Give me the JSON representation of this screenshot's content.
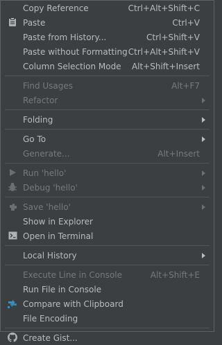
{
  "menu": {
    "groups": [
      [
        {
          "label": "Copy Reference",
          "shortcut": "Ctrl+Alt+Shift+C",
          "icon": "",
          "disabled": false,
          "submenu": false
        },
        {
          "label": "Paste",
          "shortcut": "Ctrl+V",
          "icon": "clipboard-icon",
          "disabled": false,
          "submenu": false
        },
        {
          "label": "Paste from History...",
          "shortcut": "Ctrl+Shift+V",
          "icon": "",
          "disabled": false,
          "submenu": false
        },
        {
          "label": "Paste without Formatting",
          "shortcut": "Ctrl+Alt+Shift+V",
          "icon": "",
          "disabled": false,
          "submenu": false
        },
        {
          "label": "Column Selection Mode",
          "shortcut": "Alt+Shift+Insert",
          "icon": "",
          "disabled": false,
          "submenu": false
        }
      ],
      [
        {
          "label": "Find Usages",
          "shortcut": "Alt+F7",
          "icon": "",
          "disabled": true,
          "submenu": false
        },
        {
          "label": "Refactor",
          "shortcut": "",
          "icon": "",
          "disabled": true,
          "submenu": true
        }
      ],
      [
        {
          "label": "Folding",
          "shortcut": "",
          "icon": "",
          "disabled": false,
          "submenu": true
        }
      ],
      [
        {
          "label": "Go To",
          "shortcut": "",
          "icon": "",
          "disabled": false,
          "submenu": true
        },
        {
          "label": "Generate...",
          "shortcut": "Alt+Insert",
          "icon": "",
          "disabled": true,
          "submenu": false
        }
      ],
      [
        {
          "label": "Run 'hello'",
          "shortcut": "",
          "icon": "run-icon",
          "disabled": true,
          "submenu": true
        },
        {
          "label": "Debug 'hello'",
          "shortcut": "",
          "icon": "debug-icon",
          "disabled": true,
          "submenu": true
        }
      ],
      [
        {
          "label": "Save 'hello'",
          "shortcut": "",
          "icon": "save-config-icon",
          "disabled": true,
          "submenu": true
        },
        {
          "label": "Show in Explorer",
          "shortcut": "",
          "icon": "",
          "disabled": false,
          "submenu": false
        },
        {
          "label": "Open in Terminal",
          "shortcut": "",
          "icon": "terminal-icon",
          "disabled": false,
          "submenu": false
        }
      ],
      [
        {
          "label": "Local History",
          "shortcut": "",
          "icon": "",
          "disabled": false,
          "submenu": true
        }
      ],
      [
        {
          "label": "Execute Line in Console",
          "shortcut": "Alt+Shift+E",
          "icon": "",
          "disabled": true,
          "submenu": false
        },
        {
          "label": "Run File in Console",
          "shortcut": "",
          "icon": "",
          "disabled": false,
          "submenu": false
        },
        {
          "label": "Compare with Clipboard",
          "shortcut": "",
          "icon": "compare-icon",
          "disabled": false,
          "submenu": false
        },
        {
          "label": "File Encoding",
          "shortcut": "",
          "icon": "",
          "disabled": false,
          "submenu": false
        }
      ],
      [
        {
          "label": "Create Gist...",
          "shortcut": "",
          "icon": "github-icon",
          "disabled": false,
          "submenu": false
        }
      ]
    ]
  }
}
